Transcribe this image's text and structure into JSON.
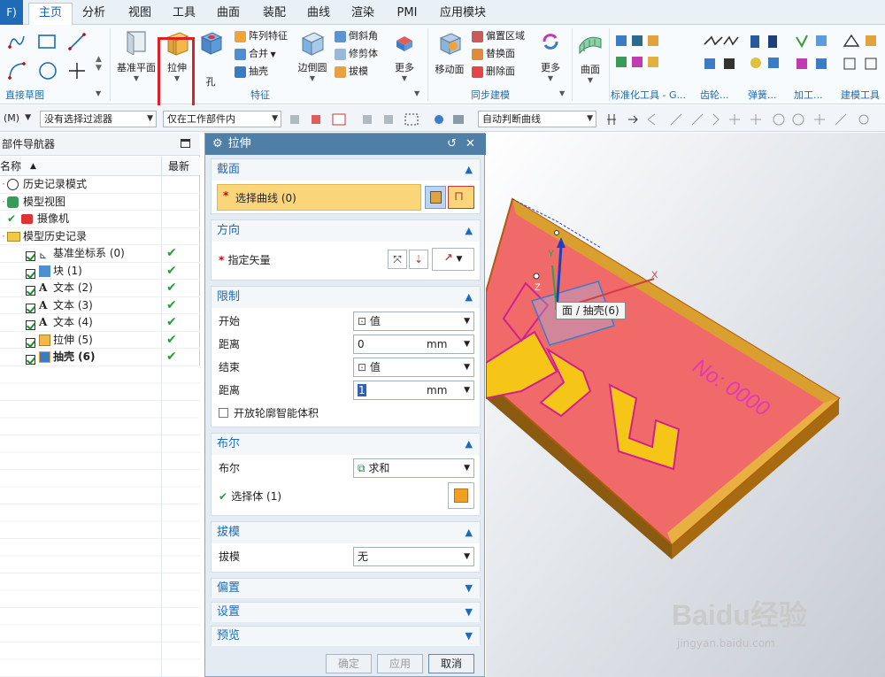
{
  "menubar": {
    "file_label": "F)",
    "items": [
      "主页",
      "分析",
      "视图",
      "工具",
      "曲面",
      "装配",
      "曲线",
      "渲染",
      "PMI",
      "应用模块"
    ],
    "active": "主页"
  },
  "ribbon": {
    "groups": {
      "direct_sketch": "直接草图",
      "feature": "特征",
      "sync_modeling": "同步建模",
      "standard_tools": "标准化工具 - G...",
      "gear": "齿轮...",
      "spring": "弹簧...",
      "machining": "加工...",
      "build_tools": "建模工具 -"
    },
    "buttons": {
      "datum_plane": "基准平面",
      "extrude": "拉伸",
      "hole": "孔",
      "edge_blend": "边倒圆",
      "more1": "更多",
      "move_face": "移动面",
      "more2": "更多",
      "surface": "曲面"
    },
    "small": {
      "pattern_feature": "阵列特征",
      "unite": "合并",
      "shell": "抽壳",
      "chamfer": "倒斜角",
      "trim_body": "修剪体",
      "draft": "拔模",
      "offset_region": "偏置区域",
      "replace_face": "替换面",
      "delete_face": "删除面"
    }
  },
  "filterbar": {
    "menu_label": "(M)",
    "filter": "没有选择过滤器",
    "scope": "仅在工作部件内",
    "curve_rule": "自动判断曲线"
  },
  "navigator": {
    "title": "部件导航器",
    "col_name": "名称",
    "col_latest": "最新",
    "rows": [
      {
        "label": "历史记录模式",
        "check": false
      },
      {
        "label": "模型视图",
        "check": false
      },
      {
        "label": "摄像机",
        "check": false
      },
      {
        "label": "模型历史记录",
        "check": false
      },
      {
        "label": "基准坐标系 (0)",
        "check": true
      },
      {
        "label": "块 (1)",
        "check": true
      },
      {
        "label": "文本 (2)",
        "check": true
      },
      {
        "label": "文本 (3)",
        "check": true
      },
      {
        "label": "文本 (4)",
        "check": true
      },
      {
        "label": "拉伸 (5)",
        "check": true
      },
      {
        "label": "抽壳 (6)",
        "check": true
      }
    ]
  },
  "dialog": {
    "title": "拉伸",
    "section": {
      "title": "截面",
      "select_curve": "选择曲线 (0)"
    },
    "direction": {
      "title": "方向",
      "specify_vector": "指定矢量"
    },
    "limits": {
      "title": "限制",
      "start_label": "开始",
      "start_value": "值",
      "distance_label": "距离",
      "start_distance": "0",
      "unit": "mm",
      "end_label": "结束",
      "end_value": "值",
      "end_distance": "1",
      "open_profile": "开放轮廓智能体积"
    },
    "boolean": {
      "title": "布尔",
      "label": "布尔",
      "value": "求和",
      "select_body": "选择体 (1)"
    },
    "draft": {
      "title": "拔模",
      "label": "拔模",
      "value": "无"
    },
    "offset": "偏置",
    "settings": "设置",
    "preview": "预览",
    "buttons": {
      "ok": "确定",
      "apply": "应用",
      "cancel": "取消"
    }
  },
  "viewport": {
    "tooltip": "面 / 抽壳(6)",
    "model_text_no": "No: 0000",
    "watermark_main": "Baidu经验",
    "watermark_url": "jingyan.baidu.com"
  }
}
